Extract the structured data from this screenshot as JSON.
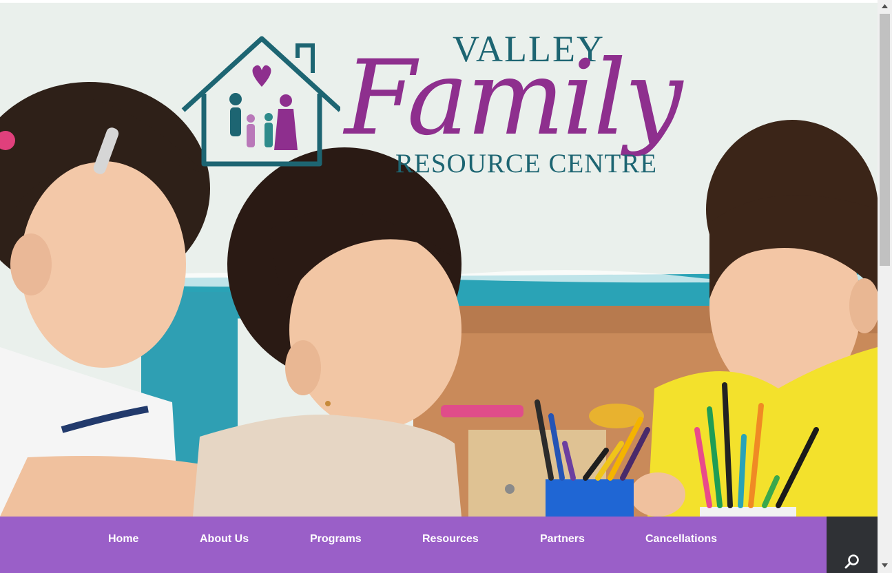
{
  "site": {
    "logo": {
      "valley": "VALLEY",
      "family": "Family",
      "resource": "RESOURCE CENTRE"
    }
  },
  "nav": {
    "items": [
      {
        "label": "Home"
      },
      {
        "label": "About Us"
      },
      {
        "label": "Programs"
      },
      {
        "label": "Resources"
      },
      {
        "label": "Partners"
      },
      {
        "label": "Cancellations"
      }
    ],
    "search_icon": "search-icon"
  },
  "colors": {
    "nav_bg": "#9a5fc8",
    "search_bg": "#2f3135",
    "logo_teal": "#1d6572",
    "logo_purple": "#8e2f8e"
  }
}
